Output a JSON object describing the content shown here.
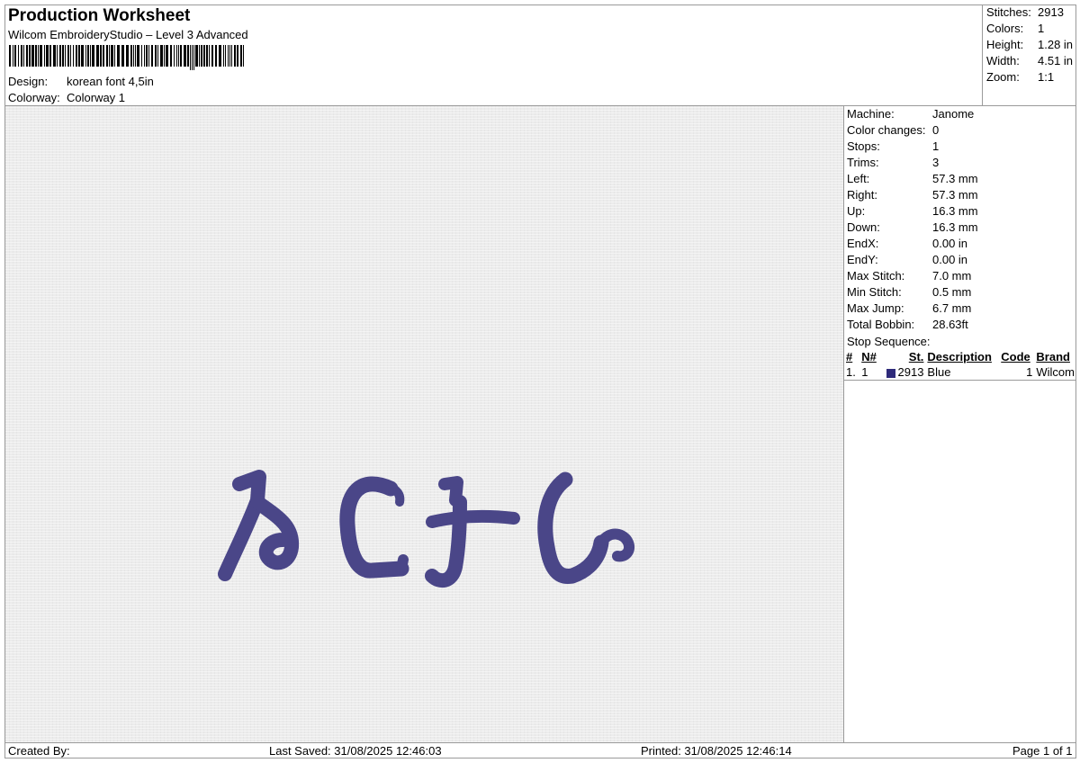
{
  "header": {
    "title": "Production Worksheet",
    "software": "Wilcom EmbroideryStudio – Level 3 Advanced",
    "design_label": "Design:",
    "design_value": "korean font 4,5in",
    "colorway_label": "Colorway:",
    "colorway_value": "Colorway 1"
  },
  "summary": [
    {
      "label": "Stitches:",
      "value": "2913"
    },
    {
      "label": "Colors:",
      "value": "1"
    },
    {
      "label": "Height:",
      "value": "1.28 in"
    },
    {
      "label": "Width:",
      "value": "4.51 in"
    },
    {
      "label": "Zoom:",
      "value": "1:1"
    }
  ],
  "machine_stats": [
    {
      "label": "Machine:",
      "value": "Janome"
    },
    {
      "label": "Color changes:",
      "value": "0"
    },
    {
      "label": "Stops:",
      "value": "1"
    },
    {
      "label": "Trims:",
      "value": "3"
    },
    {
      "label": "Left:",
      "value": "57.3 mm"
    },
    {
      "label": "Right:",
      "value": "57.3 mm"
    },
    {
      "label": "Up:",
      "value": "16.3 mm"
    },
    {
      "label": "Down:",
      "value": "16.3 mm"
    },
    {
      "label": "EndX:",
      "value": "0.00 in"
    },
    {
      "label": "EndY:",
      "value": "0.00 in"
    },
    {
      "label": "Max Stitch:",
      "value": "7.0 mm"
    },
    {
      "label": "Min Stitch:",
      "value": "0.5 mm"
    },
    {
      "label": "Max Jump:",
      "value": "6.7 mm"
    },
    {
      "label": "Total Bobbin:",
      "value": "28.63ft"
    }
  ],
  "stop_sequence": {
    "title": "Stop Sequence:",
    "columns": [
      "#",
      "N#",
      "St.",
      "Description",
      "Code",
      "Brand"
    ],
    "rows": [
      {
        "num": "1.",
        "n": "1",
        "color": "#2e2a7a",
        "stitches": "2913",
        "description": "Blue",
        "code": "1",
        "brand": "Wilcom"
      }
    ]
  },
  "design": {
    "thread_color": "#4a4688"
  },
  "footer": {
    "created_by": "Created By:",
    "last_saved": "Last Saved: 31/08/2025 12:46:03",
    "printed": "Printed: 31/08/2025 12:46:14",
    "page": "Page 1 of 1"
  }
}
